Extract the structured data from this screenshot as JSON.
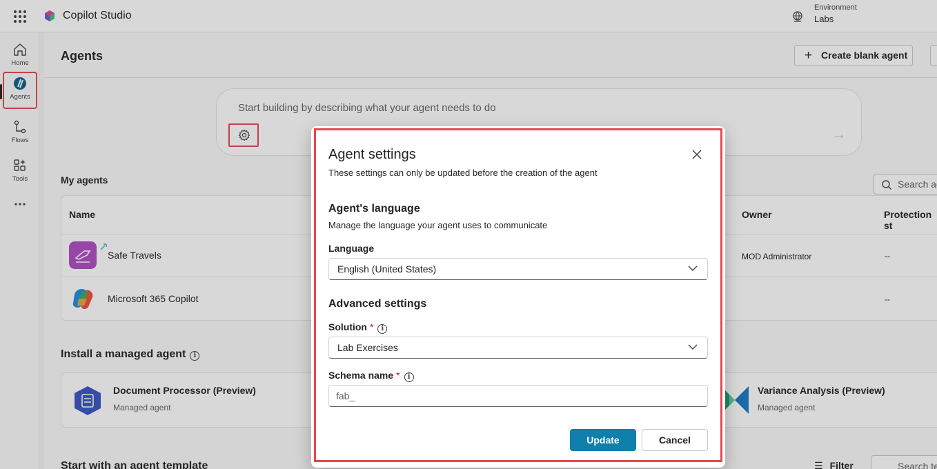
{
  "app": {
    "title": "Copilot Studio",
    "environment_label": "Environment",
    "environment_value": "Labs"
  },
  "rail": {
    "items": [
      {
        "label": "Home",
        "icon": "home-icon"
      },
      {
        "label": "Agents",
        "icon": "agents-icon"
      },
      {
        "label": "Flows",
        "icon": "flows-icon"
      },
      {
        "label": "Tools",
        "icon": "tools-icon"
      },
      {
        "label": "",
        "icon": "more-icon"
      }
    ]
  },
  "page": {
    "title": "Agents",
    "create_button": "Create blank agent",
    "prompt_placeholder": "Start building by describing what your agent needs to do"
  },
  "my_agents": {
    "title": "My agents",
    "search_placeholder": "Search ag",
    "columns": [
      "Name",
      "Owner",
      "Protection st"
    ],
    "rows": [
      {
        "name": "Safe Travels",
        "owner": "MOD Administrator",
        "protection": "--"
      },
      {
        "name": "Microsoft 365 Copilot",
        "owner": "",
        "protection": "--"
      }
    ]
  },
  "managed": {
    "title": "Install a managed agent",
    "cards": [
      {
        "title": "Document Processor (Preview)",
        "subtitle": "Managed agent"
      },
      {
        "title": "Variance Analysis (Preview)",
        "subtitle": "Managed agent"
      }
    ]
  },
  "templates": {
    "title": "Start with an agent template",
    "filter_label": "Filter",
    "search_placeholder": "Search te"
  },
  "dialog": {
    "title": "Agent settings",
    "subtitle": "These settings can only be updated before the creation of the agent",
    "language_section": "Agent's language",
    "language_desc": "Manage the language your agent uses to communicate",
    "language_label": "Language",
    "language_value": "English (United States)",
    "advanced_section": "Advanced settings",
    "solution_label": "Solution",
    "solution_value": "Lab Exercises",
    "schema_label": "Schema name",
    "schema_value": "fab_",
    "required_mark": "*",
    "update_button": "Update",
    "cancel_button": "Cancel"
  },
  "colors": {
    "accent": "#117fab",
    "highlight": "#e6484f",
    "required": "#c50f1f"
  }
}
